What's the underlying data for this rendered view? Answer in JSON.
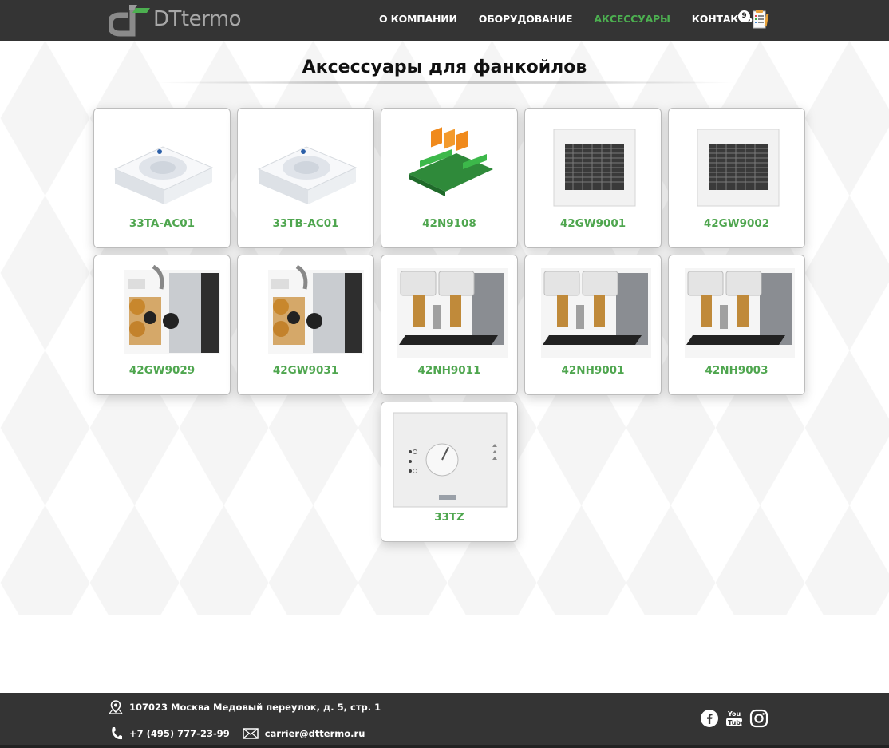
{
  "header": {
    "logo_text": "DTtermo",
    "nav": [
      {
        "label": "О КОМПАНИИ",
        "active": false
      },
      {
        "label": "ОБОРУДОВАНИЕ",
        "active": false
      },
      {
        "label": "АКСЕССУАРЫ",
        "active": true
      },
      {
        "label": "КОНТАКТЫ",
        "active": false
      }
    ],
    "cart_count": "9",
    "accent_color": "#4caf50"
  },
  "main": {
    "title": "Аксессуары для фанкойлов",
    "products": [
      {
        "label": "33TA-AC01",
        "icon": "thermostat-panel-image"
      },
      {
        "label": "33TB-AC01",
        "icon": "thermostat-panel-image"
      },
      {
        "label": "42N9108",
        "icon": "relay-board-image"
      },
      {
        "label": "42GW9001",
        "icon": "cassette-grille-image"
      },
      {
        "label": "42GW9002",
        "icon": "cassette-grille-image"
      },
      {
        "label": "42GW9029",
        "icon": "valve-kit-image"
      },
      {
        "label": "42GW9031",
        "icon": "valve-kit-image"
      },
      {
        "label": "42NH9011",
        "icon": "valve-actuator-image"
      },
      {
        "label": "42NH9001",
        "icon": "valve-actuator-image"
      },
      {
        "label": "42NH9003",
        "icon": "valve-actuator-image"
      },
      {
        "label": "33TZ",
        "icon": "wall-controller-image"
      }
    ]
  },
  "footer": {
    "address": "107023 Москва Медовый переулок, д. 5, стр. 1",
    "phone": "+7 (495) 777-23-99",
    "email": "carrier@dttermo.ru",
    "social": [
      "facebook-icon",
      "youtube-icon",
      "instagram-icon"
    ]
  }
}
